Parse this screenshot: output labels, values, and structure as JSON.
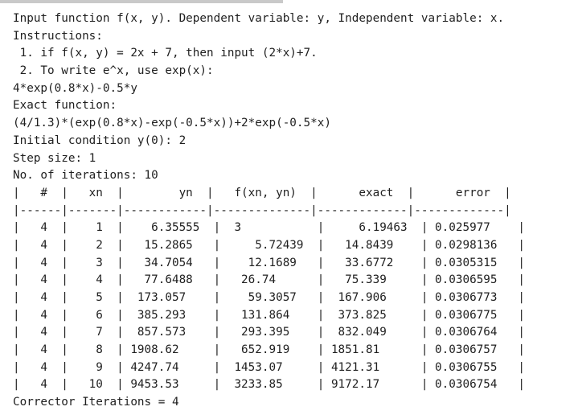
{
  "header_lines": [
    "Input function f(x, y). Dependent variable: y, Independent variable: x.",
    "Instructions:",
    " 1. if f(x, y) = 2x + 7, then input (2*x)+7.",
    " 2. To write e^x, use exp(x):",
    "4*exp(0.8*x)-0.5*y",
    "Exact function:",
    "(4/1.3)*(exp(0.8*x)-exp(-0.5*x))+2*exp(-0.5*x)",
    "Initial condition y(0): 2",
    "Step size: 1",
    "No. of iterations: 10"
  ],
  "table": {
    "header_row": "|   #  |   xn  |        yn  |   f(xn, yn)  |      exact  |      error  |",
    "separator_row": "|------|-------|------------|--------------|-------------|-------------|",
    "rows": [
      "|   4  |    1  |    6.35555  |  3           |     6.19463  | 0.025977    |",
      "|   4  |    2  |   15.2865   |     5.72439  |   14.8439    | 0.0298136   |",
      "|   4  |    3  |   34.7054   |    12.1689   |   33.6772    | 0.0305315   |",
      "|   4  |    4  |   77.6488   |   26.74      |   75.339     | 0.0306595   |",
      "|   4  |    5  |  173.057    |    59.3057   |  167.906     | 0.0306773   |",
      "|   4  |    6  |  385.293    |   131.864    |  373.825     | 0.0306775   |",
      "|   4  |    7  |  857.573    |   293.395    |  832.049     | 0.0306764   |",
      "|   4  |    8  | 1908.62     |   652.919    | 1851.81      | 0.0306757   |",
      "|   4  |    9  | 4247.74     |  1453.07     | 4121.31      | 0.0306755   |",
      "|   4  |   10  | 9453.53     |  3233.85     | 9172.17      | 0.0306754   |"
    ]
  },
  "footer_line": "Corrector Iterations = 4"
}
